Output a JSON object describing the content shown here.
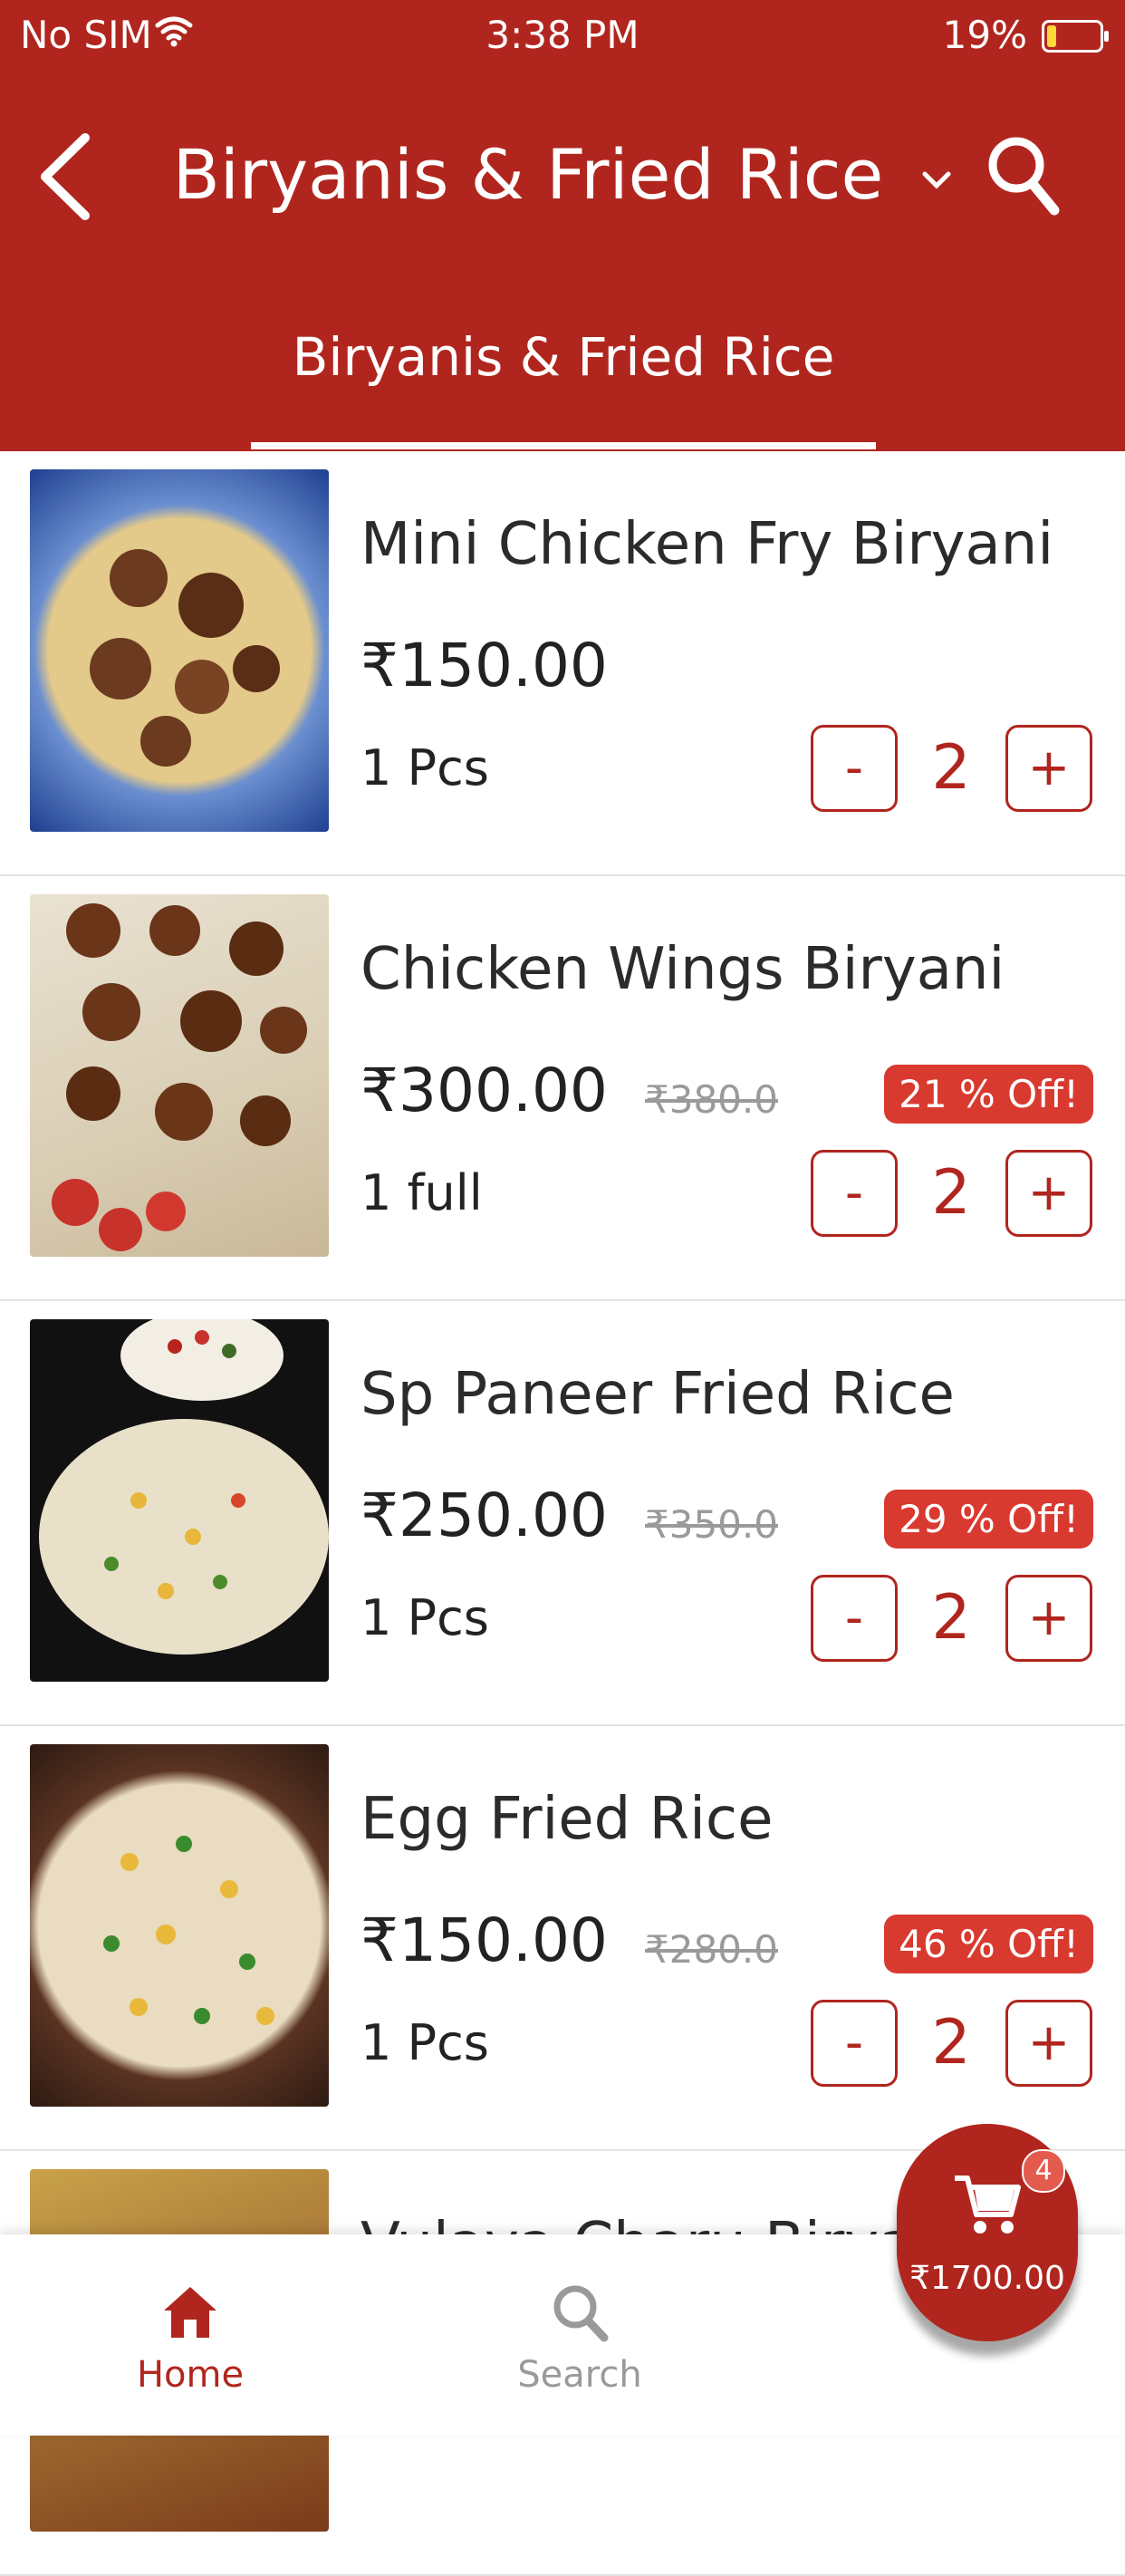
{
  "status_bar": {
    "carrier": "No SIM",
    "time": "3:38 PM",
    "battery": "19%"
  },
  "header": {
    "title": "Biryanis & Fried Rice",
    "tab": "Biryanis & Fried Rice"
  },
  "items": [
    {
      "name": "Mini Chicken Fry Biryani",
      "price": "₹150.00",
      "mrp": "",
      "off": "",
      "unit": "1 Pcs",
      "qty": "2",
      "minus": "-",
      "plus": "+"
    },
    {
      "name": "Chicken Wings Biryani",
      "price": "₹300.00",
      "mrp": "₹380.0",
      "off": "21 % Off!",
      "unit": "1 full",
      "qty": "2",
      "minus": "-",
      "plus": "+"
    },
    {
      "name": "Sp Paneer Fried Rice",
      "price": "₹250.00",
      "mrp": "₹350.0",
      "off": "29 % Off!",
      "unit": "1 Pcs",
      "qty": "2",
      "minus": "-",
      "plus": "+"
    },
    {
      "name": "Egg Fried Rice",
      "price": "₹150.00",
      "mrp": "₹280.0",
      "off": "46 % Off!",
      "unit": "1 Pcs",
      "qty": "2",
      "minus": "-",
      "plus": "+"
    },
    {
      "name": "Vulava Charu Biryani"
    }
  ],
  "bottom_nav": {
    "home": "Home",
    "search": "Search"
  },
  "cart": {
    "count": "4",
    "total": "₹1700.00"
  },
  "colors": {
    "brand": "#b0261e",
    "discount": "#d93a30"
  }
}
